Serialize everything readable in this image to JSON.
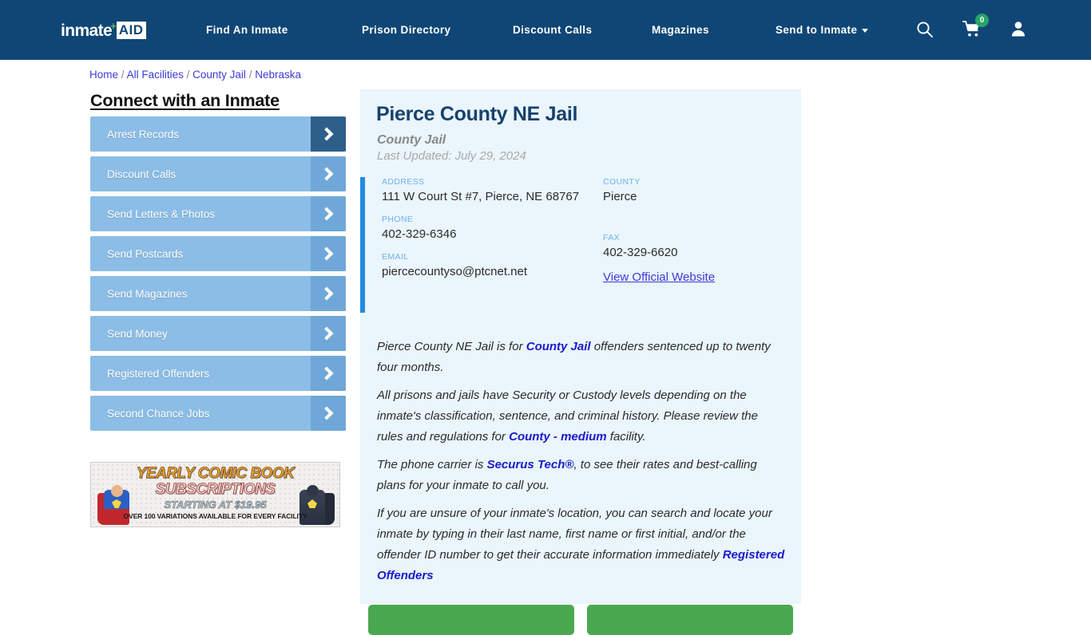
{
  "navbar": {
    "logo": {
      "word": "inmate",
      "plus": "+",
      "aid": "AID"
    },
    "links": [
      {
        "label": "Find An Inmate"
      },
      {
        "label": "Prison Directory"
      },
      {
        "label": "Discount Calls"
      },
      {
        "label": "Magazines"
      },
      {
        "label": "Send to Inmate"
      }
    ],
    "icons": {
      "search": "search-icon",
      "cart": "cart-icon",
      "cart_badge": "0",
      "user": "user-icon"
    },
    "background_color": "#0f4675"
  },
  "breadcrumb": {
    "items": [
      {
        "label": "Home"
      },
      {
        "label": "All Facilities"
      },
      {
        "label": "County Jail"
      },
      {
        "label": "Nebraska"
      }
    ],
    "separator": "/"
  },
  "sidebar": {
    "title": "Connect with an Inmate",
    "items": [
      {
        "label": "Arrest Records",
        "active": true
      },
      {
        "label": "Discount Calls",
        "active": false
      },
      {
        "label": "Send Letters & Photos",
        "active": false
      },
      {
        "label": "Send Postcards",
        "active": false
      },
      {
        "label": "Send Magazines",
        "active": false
      },
      {
        "label": "Send Money",
        "active": false
      },
      {
        "label": "Registered Offenders",
        "active": false
      },
      {
        "label": "Second Chance Jobs",
        "active": false
      }
    ],
    "ad": {
      "line1": "YEARLY COMIC BOOK",
      "line2": "SUBSCRIPTIONS",
      "line3": "STARTING AT $19.95",
      "line4": "OVER 100 VARIATIONS AVAILABLE FOR EVERY FACILITY"
    }
  },
  "facility": {
    "title": "Pierce County NE Jail",
    "type": "County Jail",
    "last_updated": "Last Updated: July 29, 2024",
    "fields": {
      "address_label": "ADDRESS",
      "address_value": "111 W Court St #7, Pierce, NE 68767",
      "phone_label": "PHONE",
      "phone_value": "402-329-6346",
      "email_label": "EMAIL",
      "email_value": "piercecountyso@ptcnet.net",
      "county_label": "COUNTY",
      "county_value": "Pierce",
      "fax_label": "FAX",
      "fax_value": "402-329-6620",
      "website_link": "View Official Website"
    },
    "paragraphs": {
      "p1_a": "Pierce County NE Jail is for ",
      "p1_b": "County Jail",
      "p1_c": " offenders sentenced up to twenty four months.",
      "p2_a": "All prisons and jails have Security or Custody levels depending on the inmate's classification, sentence, and criminal history. Please review the rules and regulations for ",
      "p2_b": "County - medium",
      "p2_c": " facility.",
      "p3_a": "The phone carrier is ",
      "p3_b": "Securus Tech®",
      "p3_c": ", to see their rates and best-calling plans for your inmate to call you.",
      "p4_a": "If you are unsure of your inmate's location, you can search and locate your inmate by typing in their last name, first name or first initial, and/or the offender ID number to get their accurate information immediately ",
      "p4_b": "Registered Offenders"
    },
    "accent_color": "#1e8ce0",
    "panel_color": "#eaf5fc"
  },
  "cta": {
    "buttons": [
      {
        "label": ""
      },
      {
        "label": ""
      }
    ],
    "color": "#4aa851"
  }
}
